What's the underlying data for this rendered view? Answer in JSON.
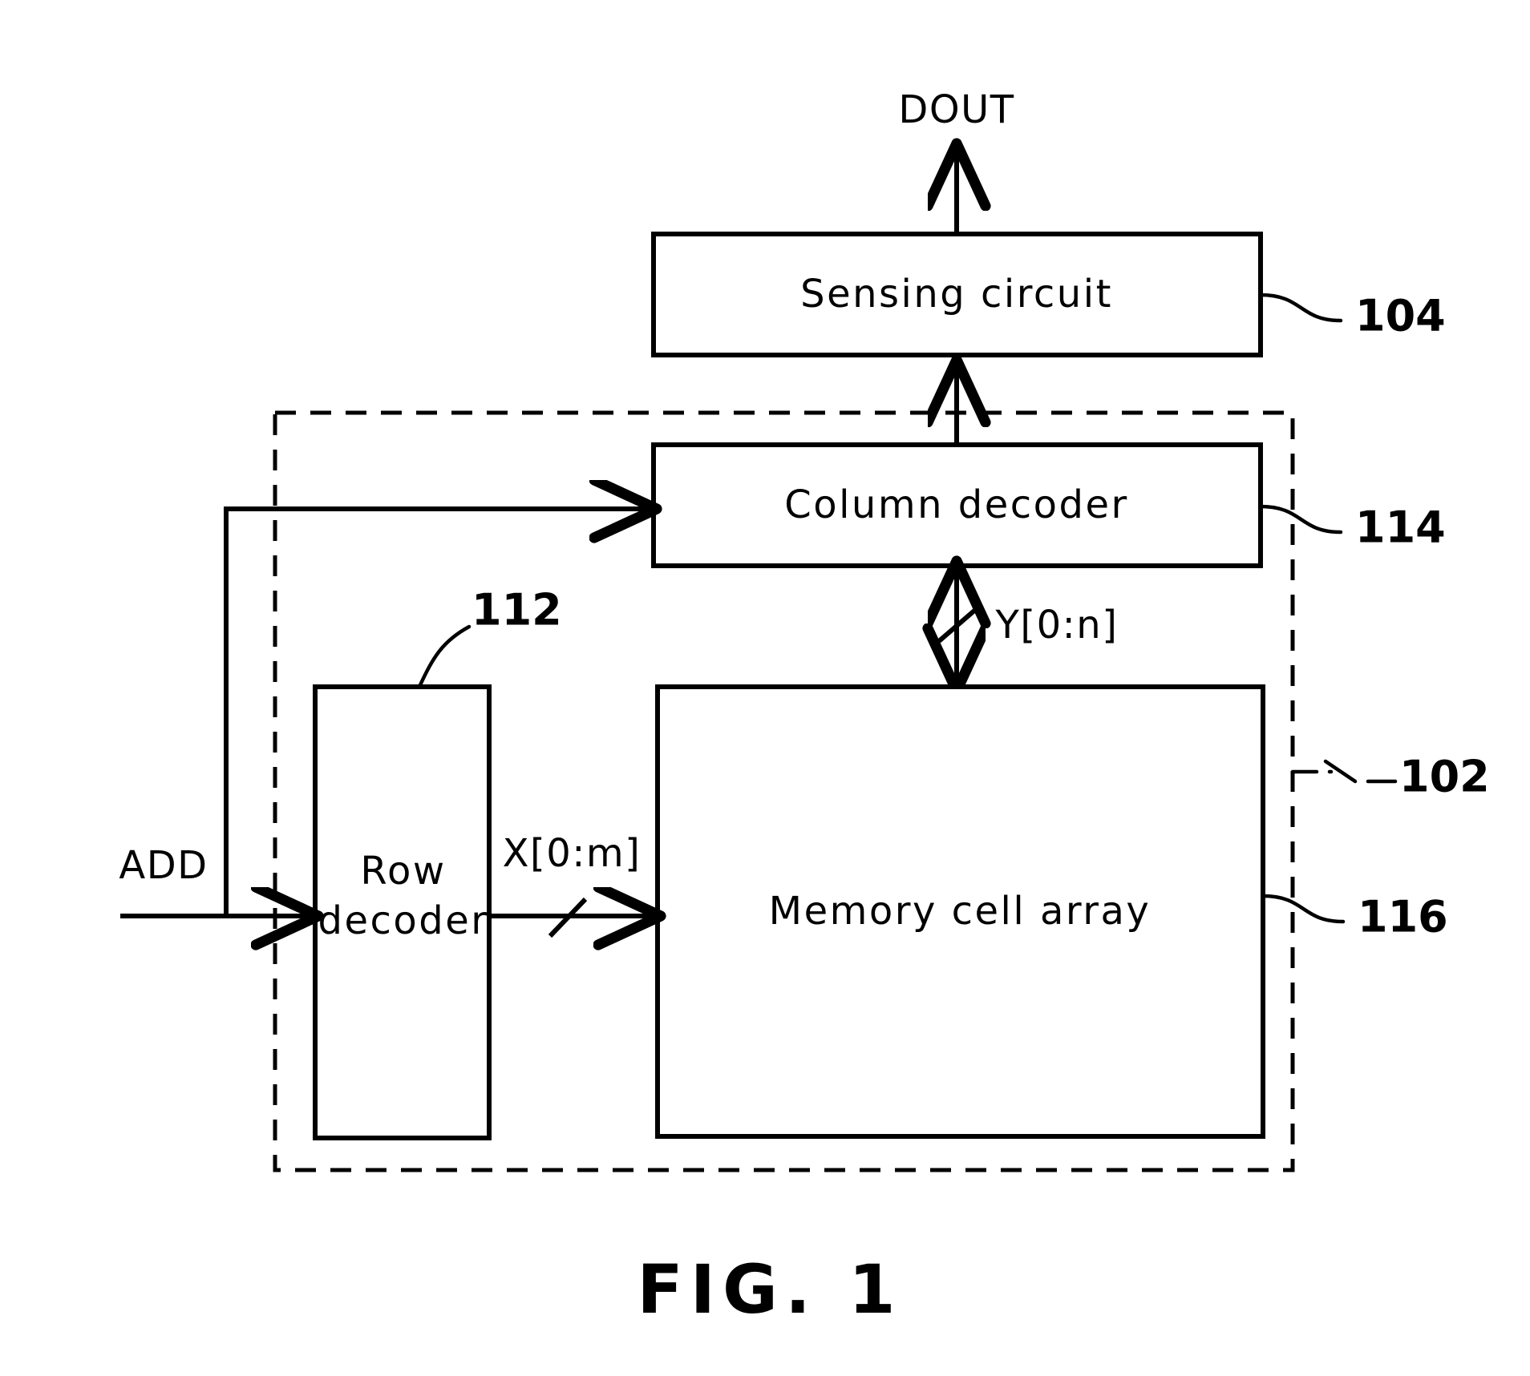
{
  "figure": {
    "caption": "FIG. 1",
    "type": "patent-block-diagram",
    "description": "Memory device block diagram"
  },
  "blocks": [
    {
      "id": "sensing_circuit",
      "label": "Sensing circuit",
      "ref": "104"
    },
    {
      "id": "column_decoder",
      "label": "Column decoder",
      "ref": "114"
    },
    {
      "id": "row_decoder",
      "label_line1": "Row",
      "label_line2": "decoder",
      "ref": "112"
    },
    {
      "id": "memory_cell_array",
      "label": "Memory cell array",
      "ref": "116"
    }
  ],
  "boundary": {
    "id": "memory_block_boundary",
    "ref": "102",
    "style": "dashed"
  },
  "signals": {
    "dout": "DOUT",
    "add": "ADD",
    "column_bus": "Y[0:n]",
    "row_bus": "X[0:m]"
  },
  "ref_numbers": {
    "sensing_circuit": "104",
    "column_decoder": "114",
    "row_decoder": "112",
    "memory_cell_array": "116",
    "boundary": "102"
  }
}
